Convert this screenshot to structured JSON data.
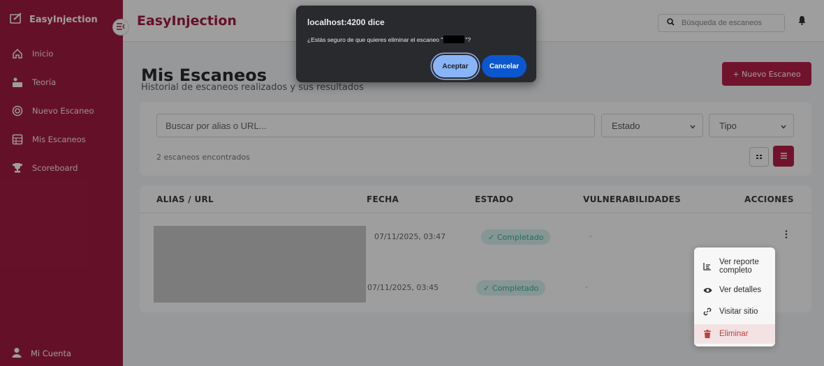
{
  "sidebar": {
    "brand": "EasyInjection",
    "items": [
      {
        "label": "Inicio",
        "icon": "home-icon"
      },
      {
        "label": "Teoría",
        "icon": "teaching-icon"
      },
      {
        "label": "Nuevo Escaneo",
        "icon": "target-icon"
      },
      {
        "label": "Mis Escaneos",
        "icon": "table-icon"
      },
      {
        "label": "Scoreboard",
        "icon": "trophy-icon"
      }
    ],
    "account": "Mi Cuenta"
  },
  "header": {
    "app_title": "EasyInjection",
    "search_placeholder": "Búsqueda de escaneos"
  },
  "main": {
    "title": "Mis Escaneos",
    "subtitle": "Historial de escaneos realizados y sus resultados",
    "new_scan_label": "+ Nuevo Escaneo",
    "filters": {
      "search_placeholder": "Buscar por alias o URL...",
      "estado": "Estado",
      "tipo": "Tipo",
      "count_text": "2 escaneos encontrados"
    },
    "table": {
      "headers": [
        "ALIAS / URL",
        "FECHA",
        "ESTADO",
        "VULNERABILIDADES",
        "ACCIONES"
      ],
      "rows": [
        {
          "fecha": "07/11/2025, 03:47",
          "estado": "✓ Completado",
          "vulnerabilidades": "-"
        },
        {
          "fecha": "07/11/2025, 03:45",
          "estado": "✓ Completado",
          "vulnerabilidades": "-"
        }
      ]
    }
  },
  "actions_menu": {
    "items": [
      "Ver reporte completo",
      "Ver detalles",
      "Visitar sitio",
      "Eliminar"
    ]
  },
  "dialog": {
    "title": "localhost:4200 dice",
    "message_prefix": "¿Estás seguro de que quieres eliminar el escaneo \"",
    "message_suffix": "\"?",
    "ok_label": "Aceptar",
    "cancel_label": "Cancelar"
  },
  "colors": {
    "brand": "#a31b43",
    "accent_button": "#b8204b",
    "badge_bg": "#d7f3ef",
    "badge_text": "#3fae9e",
    "dialog_bg": "#292a2d",
    "ok_button": "#8ab4f8",
    "cancel_button": "#0b57d0"
  }
}
